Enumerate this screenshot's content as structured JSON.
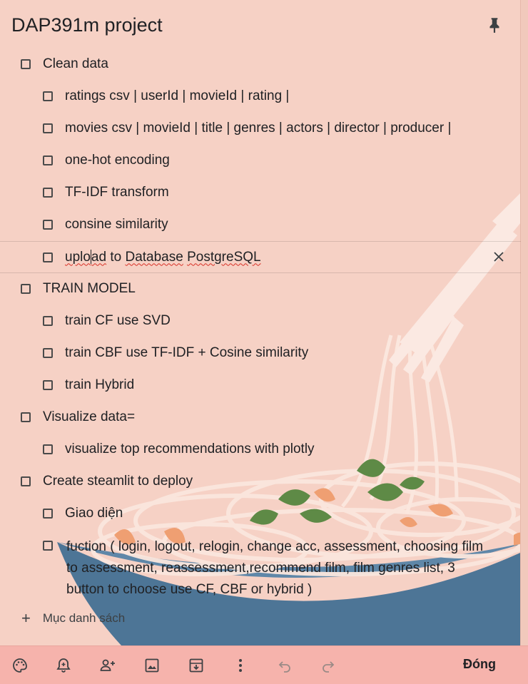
{
  "note": {
    "title": "DAP391m project",
    "items": [
      {
        "text": "Clean data",
        "level": 0
      },
      {
        "text": "ratings csv | userId | movieId | rating |",
        "level": 1
      },
      {
        "text": "movies csv | movieId | title | genres | actors | director | producer |",
        "level": 1
      },
      {
        "text": "one-hot encoding",
        "level": 1
      },
      {
        "text": "TF-IDF transform",
        "level": 1
      },
      {
        "text": "consine similarity",
        "level": 1
      },
      {
        "text_a": "uplo",
        "text_b": "ad",
        "text_c": " to ",
        "text_d": "Database",
        "text_e": " ",
        "text_f": "PostgreSQL",
        "level": 1
      },
      {
        "text": "TRAIN MODEL",
        "level": 0
      },
      {
        "text": "train CF use SVD",
        "level": 1
      },
      {
        "text": "train CBF use TF-IDF + Cosine similarity",
        "level": 1
      },
      {
        "text": "train Hybrid",
        "level": 1
      },
      {
        "text": "Visualize data=",
        "level": 0
      },
      {
        "text": "visualize top recommendations with plotly",
        "level": 1
      },
      {
        "text": "Create steamlit to deploy",
        "level": 0
      },
      {
        "text": "Giao diện",
        "level": 1
      },
      {
        "text": "fuction ( login, logout, relogin, change acc, assessment, choosing film to assessment, reassessment,recommend film, film genres list, 3 button to choose use CF, CBF or hybrid )",
        "level": 1
      }
    ],
    "add_item_label": "Mục danh sách"
  },
  "toolbar": {
    "icons": [
      "palette-icon",
      "reminder-icon",
      "collaborator-icon",
      "image-icon",
      "archive-icon",
      "more-icon",
      "undo-icon",
      "redo-icon"
    ],
    "close_label": "Đóng"
  },
  "colors": {
    "background": "#f6d1c5",
    "toolbar": "#f6b3ac",
    "bowl": "#4d7596"
  }
}
